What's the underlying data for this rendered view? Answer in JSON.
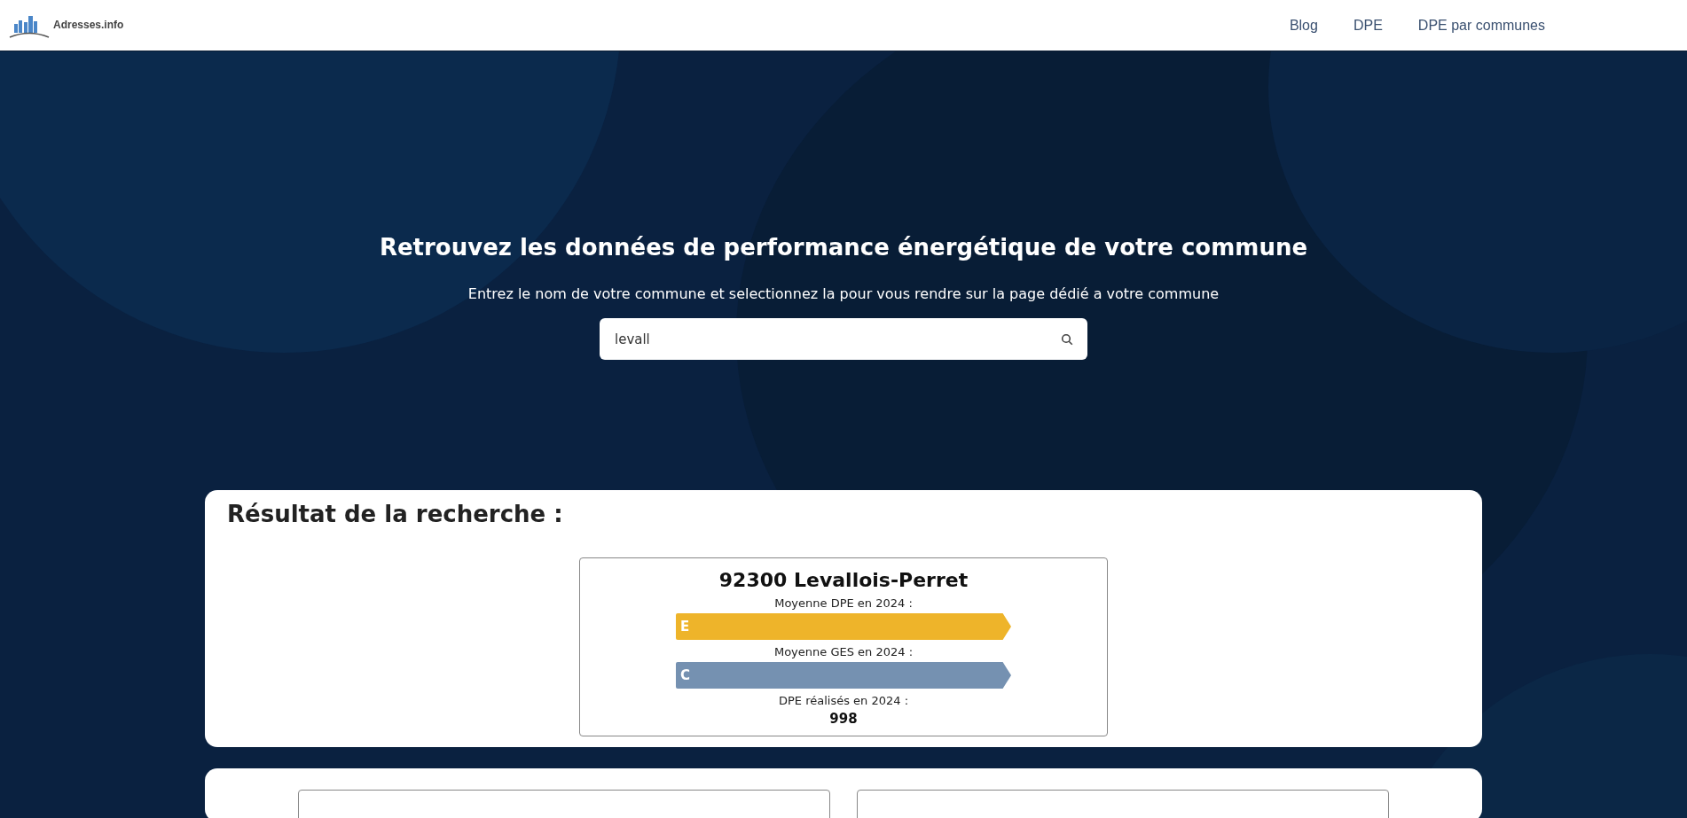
{
  "header": {
    "logo_text": "Adresses.info",
    "nav": [
      {
        "label": "Blog"
      },
      {
        "label": "DPE"
      },
      {
        "label": "DPE par communes"
      }
    ]
  },
  "hero": {
    "title": "Retrouvez les données de performance énergétique de votre commune",
    "subtitle": "Entrez le nom de votre commune et selectionnez la pour vous rendre sur la page dédié a votre commune",
    "search": {
      "value": "levall"
    }
  },
  "results": {
    "title": "Résultat de la recherche :",
    "items": [
      {
        "name": "92300 Levallois-Perret",
        "ratings": [
          {
            "label": "Moyenne DPE en 2024 :",
            "grade": "E",
            "color": "#eeb42a"
          },
          {
            "label": "Moyenne GES en 2024 :",
            "grade": "C",
            "color": "#7591b1"
          }
        ],
        "count_label": "DPE réalisés en 2024 :",
        "count": "998"
      }
    ]
  }
}
